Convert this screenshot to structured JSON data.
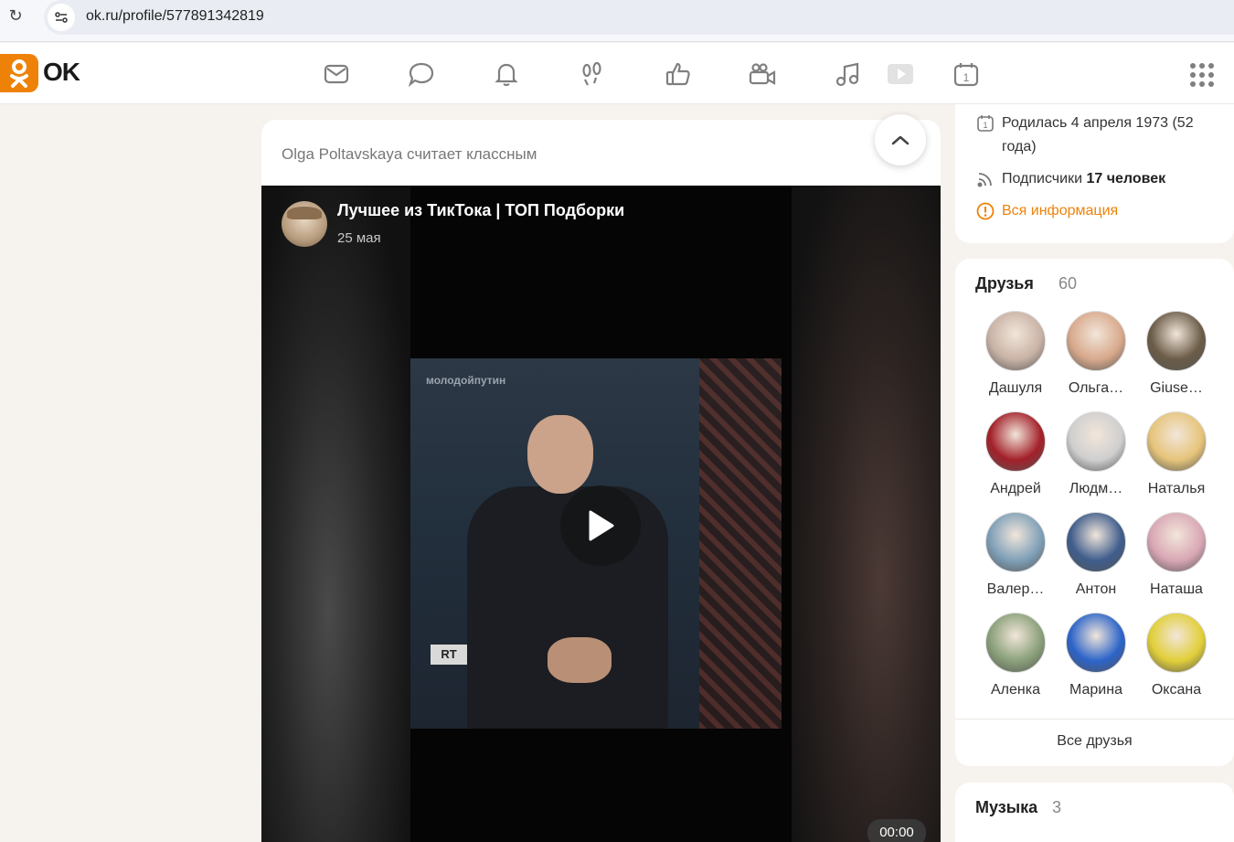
{
  "browser": {
    "url": "ok.ru/profile/577891342819"
  },
  "header": {
    "logo_text": "OK",
    "nav": [
      "mail-icon",
      "chat-icon",
      "bell-icon",
      "footprints-icon",
      "thumbs-up-icon",
      "video-camera-icon",
      "music-note-icon",
      "video-play-icon",
      "calendar-icon",
      "apps-grid-icon"
    ]
  },
  "feed": {
    "activity": "Olga Poltavskaya считает классным",
    "post": {
      "group_name": "Лучшее из ТикТока | ТОП Подборки",
      "date": "25 мая",
      "video_watermark": "молодойпутин",
      "channel_logo": "RT",
      "duration": "00:00"
    }
  },
  "profile_info": {
    "birth": "Родилась 4 апреля 1973 (52 года)",
    "subscribers_label": "Подписчики",
    "subscribers_count": "17 человек",
    "all_info": "Вся информация"
  },
  "friends": {
    "title": "Друзья",
    "count": "60",
    "items": [
      {
        "name": "Дашуля",
        "color": "#c9b3a6"
      },
      {
        "name": "Ольга…",
        "color": "#d8a98c"
      },
      {
        "name": "Giuse…",
        "color": "#6b5c48"
      },
      {
        "name": "Андрей",
        "color": "#a3202a"
      },
      {
        "name": "Людм…",
        "color": "#cfcfcf"
      },
      {
        "name": "Наталья",
        "color": "#e6c47a"
      },
      {
        "name": "Валер…",
        "color": "#7fa0b8"
      },
      {
        "name": "Антон",
        "color": "#3f5d8c"
      },
      {
        "name": "Наташа",
        "color": "#d9a7b5"
      },
      {
        "name": "Аленка",
        "color": "#8aa07a"
      },
      {
        "name": "Марина",
        "color": "#2c64c9"
      },
      {
        "name": "Оксана",
        "color": "#e1cf39"
      }
    ],
    "all_label": "Все друзья"
  },
  "music": {
    "title": "Музыка",
    "count": "3"
  },
  "colors": {
    "accent": "#ee8208",
    "page_bg": "#f6f2ee"
  }
}
